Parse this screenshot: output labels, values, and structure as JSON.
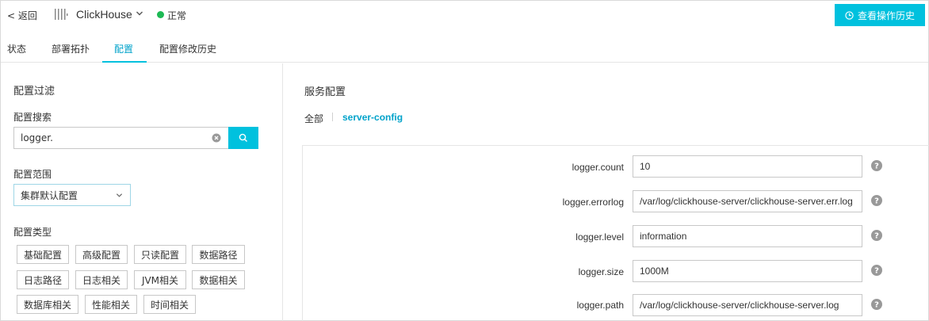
{
  "header": {
    "back_label": "< 返回",
    "service_name": "ClickHouse",
    "status": "正常",
    "status_color": "#1db954",
    "history_button": "查看操作历史"
  },
  "tabs": [
    {
      "label": "状态"
    },
    {
      "label": "部署拓扑"
    },
    {
      "label": "配置"
    },
    {
      "label": "配置修改历史"
    }
  ],
  "active_tab": "配置",
  "filter": {
    "title": "配置过滤",
    "search_label": "配置搜索",
    "search_value": "logger.",
    "scope_label": "配置范围",
    "scope_value": "集群默认配置",
    "type_label": "配置类型",
    "types": [
      "基础配置",
      "高级配置",
      "只读配置",
      "数据路径",
      "日志路径",
      "日志相关",
      "JVM相关",
      "数据相关",
      "数据库相关",
      "性能相关",
      "时间相关"
    ]
  },
  "service_config": {
    "title": "服务配置",
    "filter_all": "全部",
    "filter_server": "server-config",
    "rows": [
      {
        "key": "logger.count",
        "value": "10"
      },
      {
        "key": "logger.errorlog",
        "value": "/var/log/clickhouse-server/clickhouse-server.err.log"
      },
      {
        "key": "logger.level",
        "value": "information"
      },
      {
        "key": "logger.size",
        "value": "1000M"
      },
      {
        "key": "logger.path",
        "value": "/var/log/clickhouse-server/clickhouse-server.log"
      }
    ]
  },
  "colors": {
    "accent": "#00c1de",
    "link": "#00a2ca"
  }
}
